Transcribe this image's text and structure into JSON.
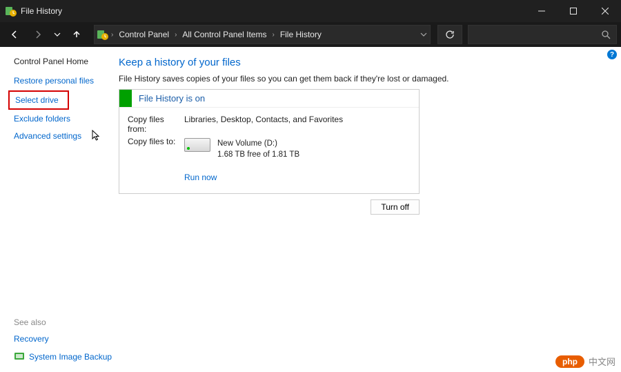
{
  "window": {
    "title": "File History"
  },
  "breadcrumbs": [
    "Control Panel",
    "All Control Panel Items",
    "File History"
  ],
  "sidebar": {
    "home": "Control Panel Home",
    "links": {
      "restore": "Restore personal files",
      "select_drive": "Select drive",
      "exclude": "Exclude folders",
      "advanced": "Advanced settings"
    },
    "seealso": "See also",
    "recovery": "Recovery",
    "system_image": "System Image Backup"
  },
  "main": {
    "heading": "Keep a history of your files",
    "description": "File History saves copies of your files so you can get them back if they're lost or damaged.",
    "status": "File History is on",
    "copy_from_label": "Copy files from:",
    "copy_from_value": "Libraries, Desktop, Contacts, and Favorites",
    "copy_to_label": "Copy files to:",
    "drive_name": "New Volume (D:)",
    "drive_free": "1.68 TB free of 1.81 TB",
    "run_now": "Run now",
    "turn_off": "Turn off"
  },
  "watermark": {
    "php": "php",
    "cn": "中文网"
  }
}
